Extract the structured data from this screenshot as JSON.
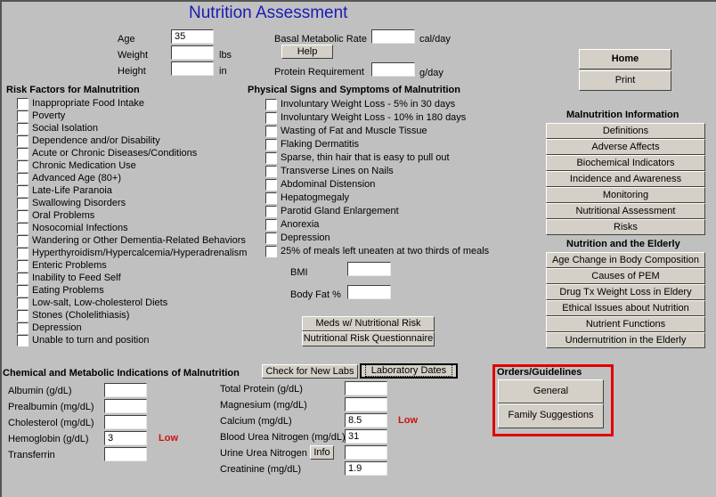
{
  "title": "Nutrition Assessment",
  "demographics": {
    "age": {
      "label": "Age",
      "value": "35",
      "unit": ""
    },
    "weight": {
      "label": "Weight",
      "value": "",
      "unit": "lbs"
    },
    "height": {
      "label": "Height",
      "value": "",
      "unit": "in"
    }
  },
  "metabolic": {
    "bmr_label": "Basal Metabolic Rate",
    "bmr_value": "",
    "bmr_unit": "cal/day",
    "help_label": "Help",
    "protein_label": "Protein Requirement",
    "protein_value": "",
    "protein_unit": "g/day"
  },
  "nav": {
    "home_label": "Home",
    "print_label": "Print"
  },
  "risk_factors": {
    "heading": "Risk Factors for Malnutrition",
    "items": [
      "Inappropriate Food Intake",
      "Poverty",
      "Social Isolation",
      "Dependence and/or Disability",
      "Acute or Chronic Diseases/Conditions",
      "Chronic Medication Use",
      "Advanced Age (80+)",
      "Late-Life Paranoia",
      "Swallowing Disorders",
      "Oral Problems",
      "Nosocomial Infections",
      "Wandering or Other Dementia-Related Behaviors",
      "Hyperthyroidism/Hypercalcemia/Hyperadrenalism",
      "Enteric Problems",
      "Inability to Feed Self",
      "Eating Problems",
      "Low-salt, Low-cholesterol Diets",
      "Stones (Cholelithiasis)",
      "Depression",
      "Unable to turn and position"
    ]
  },
  "physical_signs": {
    "heading": "Physical Signs and Symptoms of Malnutrition",
    "items": [
      "Involuntary Weight Loss - 5% in 30 days",
      "Involuntary Weight Loss - 10% in 180 days",
      "Wasting of Fat and Muscle Tissue",
      "Flaking Dermatitis",
      "Sparse, thin hair that is easy to pull out",
      "Transverse Lines on Nails",
      "Abdominal Distension",
      "Hepatogmegaly",
      "Parotid Gland Enlargement",
      "Anorexia",
      "Depression",
      "25% of meals left uneaten at two thirds of meals"
    ],
    "bmi_label": "BMI",
    "bmi_value": "",
    "bodyfat_label": "Body Fat %",
    "bodyfat_value": "",
    "meds_button": "Meds w/ Nutritional Risk",
    "questionnaire_button": "Nutritional Risk Questionnaire"
  },
  "malnutrition_info": {
    "heading": "Malnutrition Information",
    "buttons": [
      "Definitions",
      "Adverse Affects",
      "Biochemical Indicators",
      "Incidence and Awareness",
      "Monitoring",
      "Nutritional Assessment",
      "Risks"
    ]
  },
  "elderly": {
    "heading": "Nutrition and the Elderly",
    "buttons": [
      "Age Change in Body Composition",
      "Causes of PEM",
      "Drug Tx Weight Loss in Eldery",
      "Ethical Issues about Nutrition",
      "Nutrient Functions",
      "Undernutrition in the Elderly"
    ]
  },
  "chemical": {
    "heading": "Chemical and Metabolic Indications of Malnutrition",
    "check_labs_button": "Check for New Labs",
    "lab_dates_button": "Laboratory Dates",
    "left": [
      {
        "label": "Albumin (g/dL)",
        "value": "",
        "flag": ""
      },
      {
        "label": "Prealbumin (mg/dL)",
        "value": "",
        "flag": ""
      },
      {
        "label": "Cholesterol (mg/dL)",
        "value": "",
        "flag": ""
      },
      {
        "label": "Hemoglobin (g/dL)",
        "value": "3",
        "flag": "Low"
      },
      {
        "label": "Transferrin",
        "value": "",
        "flag": ""
      }
    ],
    "right": [
      {
        "label": "Total Protein (g/dL)",
        "value": "",
        "flag": ""
      },
      {
        "label": "Magnesium (mg/dL)",
        "value": "",
        "flag": ""
      },
      {
        "label": "Calcium (mg/dL)",
        "value": "8.5",
        "flag": "Low"
      },
      {
        "label": "Blood Urea Nitrogen (mg/dL)",
        "value": "31",
        "flag": ""
      },
      {
        "label": "Urine Urea Nitrogen",
        "value": "",
        "flag": ""
      },
      {
        "label": "Creatinine (mg/dL)",
        "value": "1.9",
        "flag": ""
      }
    ],
    "info_button": "Info"
  },
  "orders": {
    "heading": "Orders/Guidelines",
    "general_button": "General",
    "family_button": "Family Suggestions"
  },
  "colors": {
    "title": "#1a1ab8",
    "flag_low": "#d01010",
    "highlight_box": "#e00000",
    "background": "#c0c0c0",
    "button_face": "#d4d0c8"
  }
}
